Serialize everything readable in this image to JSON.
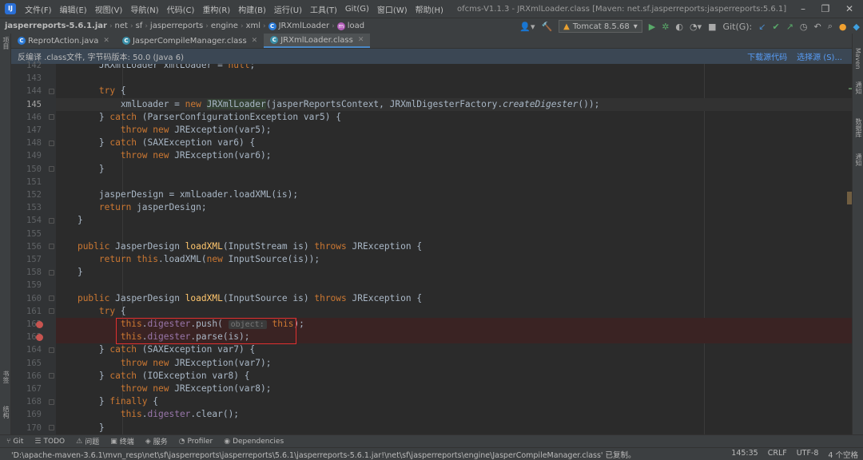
{
  "menubar": {
    "logo": "IJ",
    "items": [
      "文件(F)",
      "编辑(E)",
      "视图(V)",
      "导航(N)",
      "代码(C)",
      "重构(R)",
      "构建(B)",
      "运行(U)",
      "工具(T)",
      "Git(G)",
      "窗口(W)",
      "帮助(H)"
    ],
    "title": "ofcms-V1.1.3 - JRXmlLoader.class [Maven: net.sf.jasperreports:jasperreports:5.6.1]"
  },
  "breadcrumb": [
    "jasperreports-5.6.1.jar",
    "net",
    "sf",
    "jasperreports",
    "engine",
    "xml",
    "JRXmlLoader",
    "load"
  ],
  "toolbar": {
    "run_config": "Tomcat 8.5.68",
    "git_label": "Git(G):"
  },
  "tabs": [
    {
      "label": "ReprotAction.java",
      "icon": "C",
      "active": false
    },
    {
      "label": "JasperCompileManager.class",
      "icon": "C",
      "active": false
    },
    {
      "label": "JRXmlLoader.class",
      "icon": "C",
      "active": true
    }
  ],
  "banner": {
    "text": "反编译 .class文件, 字节码版本: 50.0 (Java 6)",
    "download": "下载源代码",
    "choose": "选择源 (S)..."
  },
  "editor": {
    "line_numbers": [
      "142",
      "143",
      "144",
      "145",
      "146",
      "147",
      "148",
      "149",
      "150",
      "151",
      "152",
      "153",
      "154",
      "155",
      "156",
      "157",
      "158",
      "159",
      "160",
      "161",
      "162",
      "163",
      "164",
      "165",
      "166",
      "167",
      "168",
      "169",
      "170"
    ],
    "current_line": "145",
    "breakpoint_lines": [
      "162",
      "163"
    ],
    "param_hint": "object:"
  },
  "left_strip": [
    "项目",
    "书签",
    "结构"
  ],
  "right_strip": [
    "Maven",
    "通知",
    "数据库",
    "通知"
  ],
  "tool_windows": [
    {
      "icon": "⑂",
      "label": "Git"
    },
    {
      "icon": "☰",
      "label": "TODO"
    },
    {
      "icon": "⚠",
      "label": "问题"
    },
    {
      "icon": "▣",
      "label": "终端"
    },
    {
      "icon": "◈",
      "label": "服务"
    },
    {
      "icon": "◔",
      "label": "Profiler"
    },
    {
      "icon": "◉",
      "label": "Dependencies"
    }
  ],
  "status": {
    "message": "'D:\\apache-maven-3.6.1\\mvn_resp\\net\\sf\\jasperreports\\jasperreports\\5.6.1\\jasperreports-5.6.1.jar!\\net\\sf\\jasperreports\\engine\\JasperCompileManager.class' 已复制。",
    "position": "145:35",
    "line_sep": "CRLF",
    "encoding": "UTF-8",
    "indent": "4 个空格"
  },
  "colors": {
    "keyword": "#cc7832",
    "method": "#ffc66d",
    "field": "#9876aa",
    "breakpoint": "#c75450",
    "highlight_box": "#e03030"
  }
}
